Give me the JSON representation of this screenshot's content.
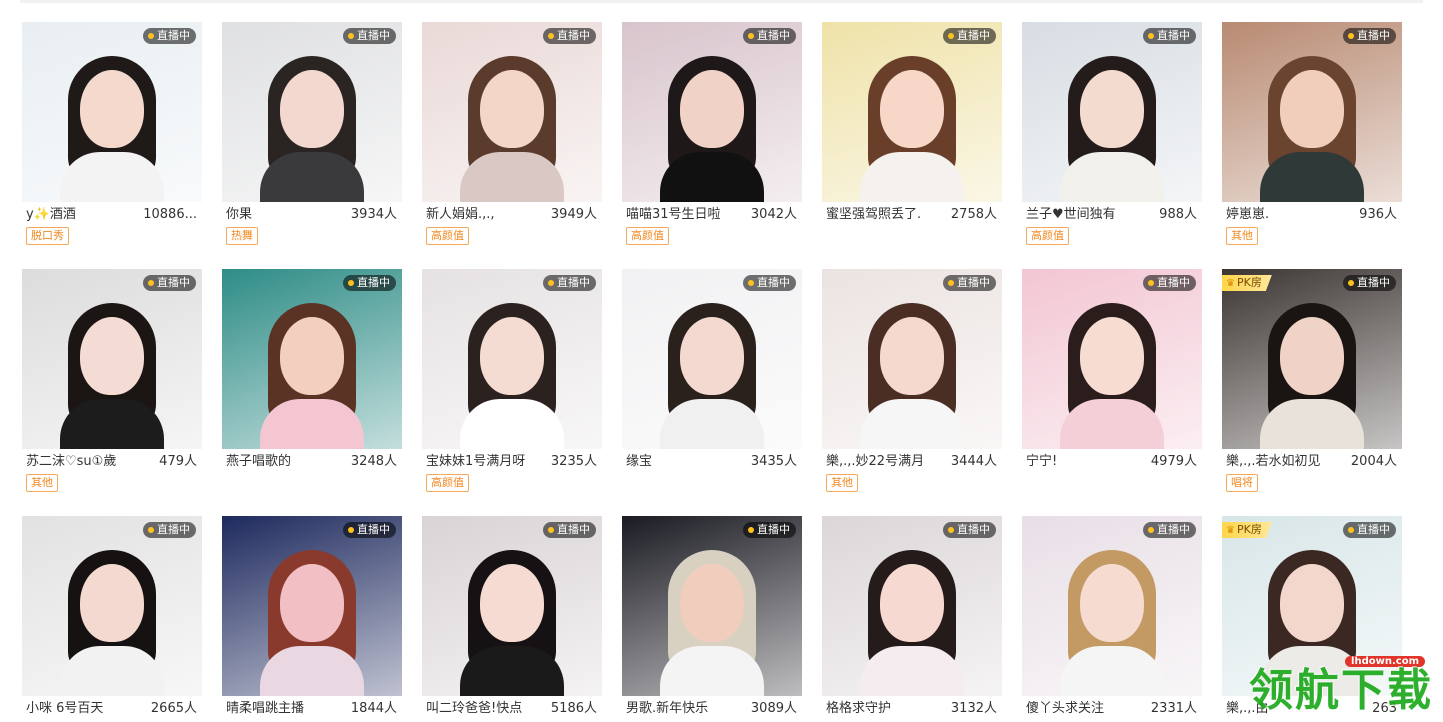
{
  "live_label": "直播中",
  "pk_label": "PK房",
  "watermark": {
    "site": "lhdown.com",
    "text": "领航下载"
  },
  "rows": [
    [
      {
        "name": "y✨酒酒",
        "count": "10886...",
        "tag": "脱口秀",
        "pk": false,
        "bg": "#e8eef2",
        "hair": "#1f1a17",
        "skin": "#f5d9cc",
        "cloth": "#f3f3f3"
      },
      {
        "name": "你果",
        "count": "3934人",
        "tag": "热舞",
        "pk": false,
        "bg": "#dfe0e2",
        "hair": "#2a2422",
        "skin": "#f2d8cf",
        "cloth": "#3a3a3c"
      },
      {
        "name": "新人娟娟.,.,",
        "count": "3949人",
        "tag": "高颜值",
        "pk": false,
        "bg": "#e9d9d7",
        "hair": "#5a3b2c",
        "skin": "#f4d6c8",
        "cloth": "#d9c8c4"
      },
      {
        "name": "喵喵31号生日啦",
        "count": "3042人",
        "tag": "高颜值",
        "pk": false,
        "bg": "#d8c4cc",
        "hair": "#1e1818",
        "skin": "#f0d2c6",
        "cloth": "#111111"
      },
      {
        "name": "蜜坚强驾照丢了.",
        "count": "2758人",
        "tag": "",
        "pk": false,
        "bg": "#efe2a8",
        "hair": "#6a3f2a",
        "skin": "#f7d8c8",
        "cloth": "#f4f1ee"
      },
      {
        "name": "兰子♥世间独有",
        "count": "988人",
        "tag": "高颜值",
        "pk": false,
        "bg": "#d7dde3",
        "hair": "#241c1a",
        "skin": "#f3dbd0",
        "cloth": "#f2f0ea"
      },
      {
        "name": "婷崽崽.",
        "count": "936人",
        "tag": "其他",
        "pk": false,
        "bg": "#b88a72",
        "hair": "#6b4430",
        "skin": "#f1cdbb",
        "cloth": "#2f3a38"
      }
    ],
    [
      {
        "name": "苏二沫♡su①歲",
        "count": "479人",
        "tag": "其他",
        "pk": false,
        "bg": "#dcdcdc",
        "hair": "#1b1514",
        "skin": "#f4dbd3",
        "cloth": "#1c1c1c"
      },
      {
        "name": "燕子唱歌的",
        "count": "3248人",
        "tag": "",
        "pk": false,
        "bg": "#2e8c86",
        "hair": "#5a3324",
        "skin": "#f3cfc0",
        "cloth": "#f4c6d2"
      },
      {
        "name": "宝妹妹1号满月呀",
        "count": "3235人",
        "tag": "高颜值",
        "pk": false,
        "bg": "#e6e2e3",
        "hair": "#2b2220",
        "skin": "#f5dcd3",
        "cloth": "#ffffff"
      },
      {
        "name": "缘宝",
        "count": "3435人",
        "tag": "",
        "pk": false,
        "bg": "#f1f1f3",
        "hair": "#2a201c",
        "skin": "#f3d9cf",
        "cloth": "#f0f0f0"
      },
      {
        "name": "樂,.,.妙22号满月",
        "count": "3444人",
        "tag": "其他",
        "pk": false,
        "bg": "#ebe3e1",
        "hair": "#4a2e24",
        "skin": "#f5d9cf",
        "cloth": "#f6f6f6"
      },
      {
        "name": "宁宁!",
        "count": "4979人",
        "tag": "",
        "pk": false,
        "bg": "#f2c6d3",
        "hair": "#2a1d1b",
        "skin": "#f7dcd2",
        "cloth": "#f4cfd8"
      },
      {
        "name": "樂,.,.若水如初见",
        "count": "2004人",
        "tag": "唱将",
        "pk": true,
        "bg": "#3b3532",
        "hair": "#1a1413",
        "skin": "#f0d3c6",
        "cloth": "#e8e2da"
      }
    ],
    [
      {
        "name": "小咪 6号百天",
        "count": "2665人",
        "tag": "",
        "pk": false,
        "bg": "#e2e2e2",
        "hair": "#161212",
        "skin": "#f3d9cf",
        "cloth": "#f2f2f2"
      },
      {
        "name": "晴柔唱跳主播",
        "count": "1844人",
        "tag": "",
        "pk": false,
        "bg": "#1e2a5e",
        "hair": "#8a3a2c",
        "skin": "#f2c0c4",
        "cloth": "#e9d7e2"
      },
      {
        "name": "叫二玲爸爸!快点",
        "count": "5186人",
        "tag": "",
        "pk": false,
        "bg": "#d9d3d6",
        "hair": "#161112",
        "skin": "#f5dbd2",
        "cloth": "#1a1a1a"
      },
      {
        "name": "男歌.新年快乐",
        "count": "3089人",
        "tag": "",
        "pk": false,
        "bg": "#1a1a22",
        "hair": "#d8d0c0",
        "skin": "#f1cdbd",
        "cloth": "#f4f4f4"
      },
      {
        "name": "格格求守护",
        "count": "3132人",
        "tag": "",
        "pk": false,
        "bg": "#dcd6d8",
        "hair": "#241b1a",
        "skin": "#f6dad1",
        "cloth": "#f4ecee"
      },
      {
        "name": "傻丫头求关注",
        "count": "2331人",
        "tag": "",
        "pk": false,
        "bg": "#e8dfe6",
        "hair": "#c39a64",
        "skin": "#f5dbd0",
        "cloth": "#f5f5f5"
      },
      {
        "name": "樂,.,.由",
        "count": "263",
        "tag": "",
        "pk": true,
        "bg": "#d8e6e8",
        "hair": "#3b2822",
        "skin": "#f3d7cc",
        "cloth": "#ecebe8"
      }
    ]
  ]
}
